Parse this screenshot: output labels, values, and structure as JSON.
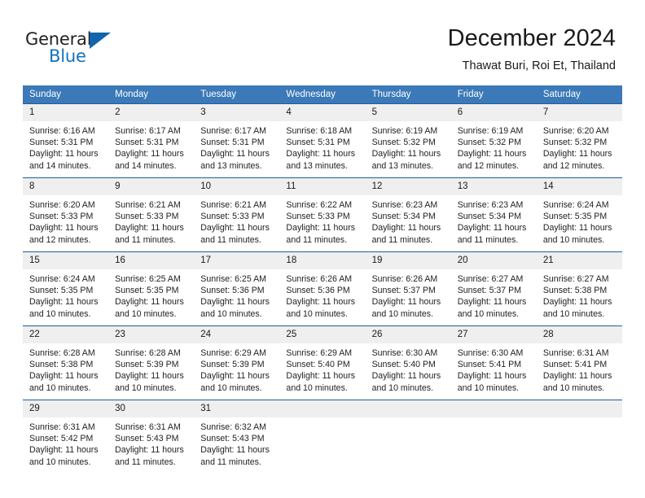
{
  "brand": {
    "name_top": "General",
    "name_bottom": "Blue",
    "color_blue": "#1473bb",
    "color_triangle": "#1065ab"
  },
  "header": {
    "title": "December 2024",
    "subtitle": "Thawat Buri, Roi Et, Thailand"
  },
  "theme": {
    "header_row_bg": "#3b79b8",
    "row_divider": "#1f5fa0",
    "daynum_bg": "#efefef"
  },
  "weekday_headers": [
    "Sunday",
    "Monday",
    "Tuesday",
    "Wednesday",
    "Thursday",
    "Friday",
    "Saturday"
  ],
  "weeks": [
    [
      {
        "day": "1",
        "lines": [
          "Sunrise: 6:16 AM",
          "Sunset: 5:31 PM",
          "Daylight: 11 hours",
          "and 14 minutes."
        ]
      },
      {
        "day": "2",
        "lines": [
          "Sunrise: 6:17 AM",
          "Sunset: 5:31 PM",
          "Daylight: 11 hours",
          "and 14 minutes."
        ]
      },
      {
        "day": "3",
        "lines": [
          "Sunrise: 6:17 AM",
          "Sunset: 5:31 PM",
          "Daylight: 11 hours",
          "and 13 minutes."
        ]
      },
      {
        "day": "4",
        "lines": [
          "Sunrise: 6:18 AM",
          "Sunset: 5:31 PM",
          "Daylight: 11 hours",
          "and 13 minutes."
        ]
      },
      {
        "day": "5",
        "lines": [
          "Sunrise: 6:19 AM",
          "Sunset: 5:32 PM",
          "Daylight: 11 hours",
          "and 13 minutes."
        ]
      },
      {
        "day": "6",
        "lines": [
          "Sunrise: 6:19 AM",
          "Sunset: 5:32 PM",
          "Daylight: 11 hours",
          "and 12 minutes."
        ]
      },
      {
        "day": "7",
        "lines": [
          "Sunrise: 6:20 AM",
          "Sunset: 5:32 PM",
          "Daylight: 11 hours",
          "and 12 minutes."
        ]
      }
    ],
    [
      {
        "day": "8",
        "lines": [
          "Sunrise: 6:20 AM",
          "Sunset: 5:33 PM",
          "Daylight: 11 hours",
          "and 12 minutes."
        ]
      },
      {
        "day": "9",
        "lines": [
          "Sunrise: 6:21 AM",
          "Sunset: 5:33 PM",
          "Daylight: 11 hours",
          "and 11 minutes."
        ]
      },
      {
        "day": "10",
        "lines": [
          "Sunrise: 6:21 AM",
          "Sunset: 5:33 PM",
          "Daylight: 11 hours",
          "and 11 minutes."
        ]
      },
      {
        "day": "11",
        "lines": [
          "Sunrise: 6:22 AM",
          "Sunset: 5:33 PM",
          "Daylight: 11 hours",
          "and 11 minutes."
        ]
      },
      {
        "day": "12",
        "lines": [
          "Sunrise: 6:23 AM",
          "Sunset: 5:34 PM",
          "Daylight: 11 hours",
          "and 11 minutes."
        ]
      },
      {
        "day": "13",
        "lines": [
          "Sunrise: 6:23 AM",
          "Sunset: 5:34 PM",
          "Daylight: 11 hours",
          "and 11 minutes."
        ]
      },
      {
        "day": "14",
        "lines": [
          "Sunrise: 6:24 AM",
          "Sunset: 5:35 PM",
          "Daylight: 11 hours",
          "and 10 minutes."
        ]
      }
    ],
    [
      {
        "day": "15",
        "lines": [
          "Sunrise: 6:24 AM",
          "Sunset: 5:35 PM",
          "Daylight: 11 hours",
          "and 10 minutes."
        ]
      },
      {
        "day": "16",
        "lines": [
          "Sunrise: 6:25 AM",
          "Sunset: 5:35 PM",
          "Daylight: 11 hours",
          "and 10 minutes."
        ]
      },
      {
        "day": "17",
        "lines": [
          "Sunrise: 6:25 AM",
          "Sunset: 5:36 PM",
          "Daylight: 11 hours",
          "and 10 minutes."
        ]
      },
      {
        "day": "18",
        "lines": [
          "Sunrise: 6:26 AM",
          "Sunset: 5:36 PM",
          "Daylight: 11 hours",
          "and 10 minutes."
        ]
      },
      {
        "day": "19",
        "lines": [
          "Sunrise: 6:26 AM",
          "Sunset: 5:37 PM",
          "Daylight: 11 hours",
          "and 10 minutes."
        ]
      },
      {
        "day": "20",
        "lines": [
          "Sunrise: 6:27 AM",
          "Sunset: 5:37 PM",
          "Daylight: 11 hours",
          "and 10 minutes."
        ]
      },
      {
        "day": "21",
        "lines": [
          "Sunrise: 6:27 AM",
          "Sunset: 5:38 PM",
          "Daylight: 11 hours",
          "and 10 minutes."
        ]
      }
    ],
    [
      {
        "day": "22",
        "lines": [
          "Sunrise: 6:28 AM",
          "Sunset: 5:38 PM",
          "Daylight: 11 hours",
          "and 10 minutes."
        ]
      },
      {
        "day": "23",
        "lines": [
          "Sunrise: 6:28 AM",
          "Sunset: 5:39 PM",
          "Daylight: 11 hours",
          "and 10 minutes."
        ]
      },
      {
        "day": "24",
        "lines": [
          "Sunrise: 6:29 AM",
          "Sunset: 5:39 PM",
          "Daylight: 11 hours",
          "and 10 minutes."
        ]
      },
      {
        "day": "25",
        "lines": [
          "Sunrise: 6:29 AM",
          "Sunset: 5:40 PM",
          "Daylight: 11 hours",
          "and 10 minutes."
        ]
      },
      {
        "day": "26",
        "lines": [
          "Sunrise: 6:30 AM",
          "Sunset: 5:40 PM",
          "Daylight: 11 hours",
          "and 10 minutes."
        ]
      },
      {
        "day": "27",
        "lines": [
          "Sunrise: 6:30 AM",
          "Sunset: 5:41 PM",
          "Daylight: 11 hours",
          "and 10 minutes."
        ]
      },
      {
        "day": "28",
        "lines": [
          "Sunrise: 6:31 AM",
          "Sunset: 5:41 PM",
          "Daylight: 11 hours",
          "and 10 minutes."
        ]
      }
    ],
    [
      {
        "day": "29",
        "lines": [
          "Sunrise: 6:31 AM",
          "Sunset: 5:42 PM",
          "Daylight: 11 hours",
          "and 10 minutes."
        ]
      },
      {
        "day": "30",
        "lines": [
          "Sunrise: 6:31 AM",
          "Sunset: 5:43 PM",
          "Daylight: 11 hours",
          "and 11 minutes."
        ]
      },
      {
        "day": "31",
        "lines": [
          "Sunrise: 6:32 AM",
          "Sunset: 5:43 PM",
          "Daylight: 11 hours",
          "and 11 minutes."
        ]
      },
      {
        "day": "",
        "lines": []
      },
      {
        "day": "",
        "lines": []
      },
      {
        "day": "",
        "lines": []
      },
      {
        "day": "",
        "lines": []
      }
    ]
  ]
}
